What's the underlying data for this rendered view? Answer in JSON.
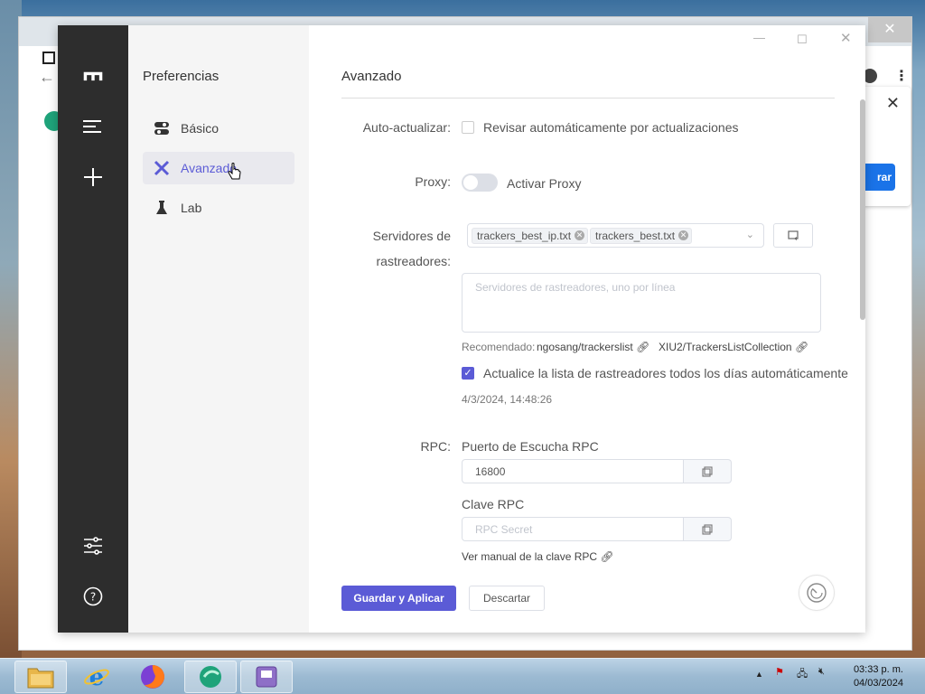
{
  "app": {
    "sidebar_icons": [
      "motrix-logo-icon",
      "menu-icon",
      "add-icon",
      "sliders-icon",
      "help-icon"
    ],
    "pref_title": "Preferencias",
    "pref_items": [
      {
        "label": "Básico",
        "icon": "toggle-icon"
      },
      {
        "label": "Avanzado",
        "icon": "tools-icon",
        "active": true
      },
      {
        "label": "Lab",
        "icon": "flask-icon"
      }
    ]
  },
  "content": {
    "title": "Avanzado",
    "auto_update": {
      "label": "Auto-actualizar:",
      "checkbox_label": "Revisar automáticamente por actualizaciones",
      "checked": false
    },
    "proxy": {
      "label": "Proxy:",
      "toggle_label": "Activar Proxy",
      "enabled": false
    },
    "trackers": {
      "label_line1": "Servidores de",
      "label_line2": "rastreadores:",
      "tags": [
        "trackers_best_ip.txt",
        "trackers_best.txt"
      ],
      "textarea_placeholder": "Servidores de rastreadores, uno por línea",
      "recommended_label": "Recomendado:",
      "recommended_links": [
        "ngosang/trackerslist",
        "XIU2/TrackersListCollection"
      ],
      "auto_update_label": "Actualice la lista de rastreadores todos los días automáticamente",
      "auto_update_checked": true,
      "last_update": "4/3/2024, 14:48:26"
    },
    "rpc": {
      "label": "RPC:",
      "port_label": "Puerto de Escucha RPC",
      "port_value": "16800",
      "secret_label": "Clave RPC",
      "secret_placeholder": "RPC Secret",
      "manual_link": "Ver manual de la clave RPC"
    },
    "buttons": {
      "save": "Guardar y Aplicar",
      "discard": "Descartar"
    }
  },
  "background": {
    "popup_button": "rar"
  },
  "taskbar": {
    "time": "03:33 p. m.",
    "date": "04/03/2024"
  },
  "colors": {
    "accent": "#5b5bd6",
    "sidebar": "#2d2d2d",
    "menu_bg": "#f5f5f5"
  }
}
